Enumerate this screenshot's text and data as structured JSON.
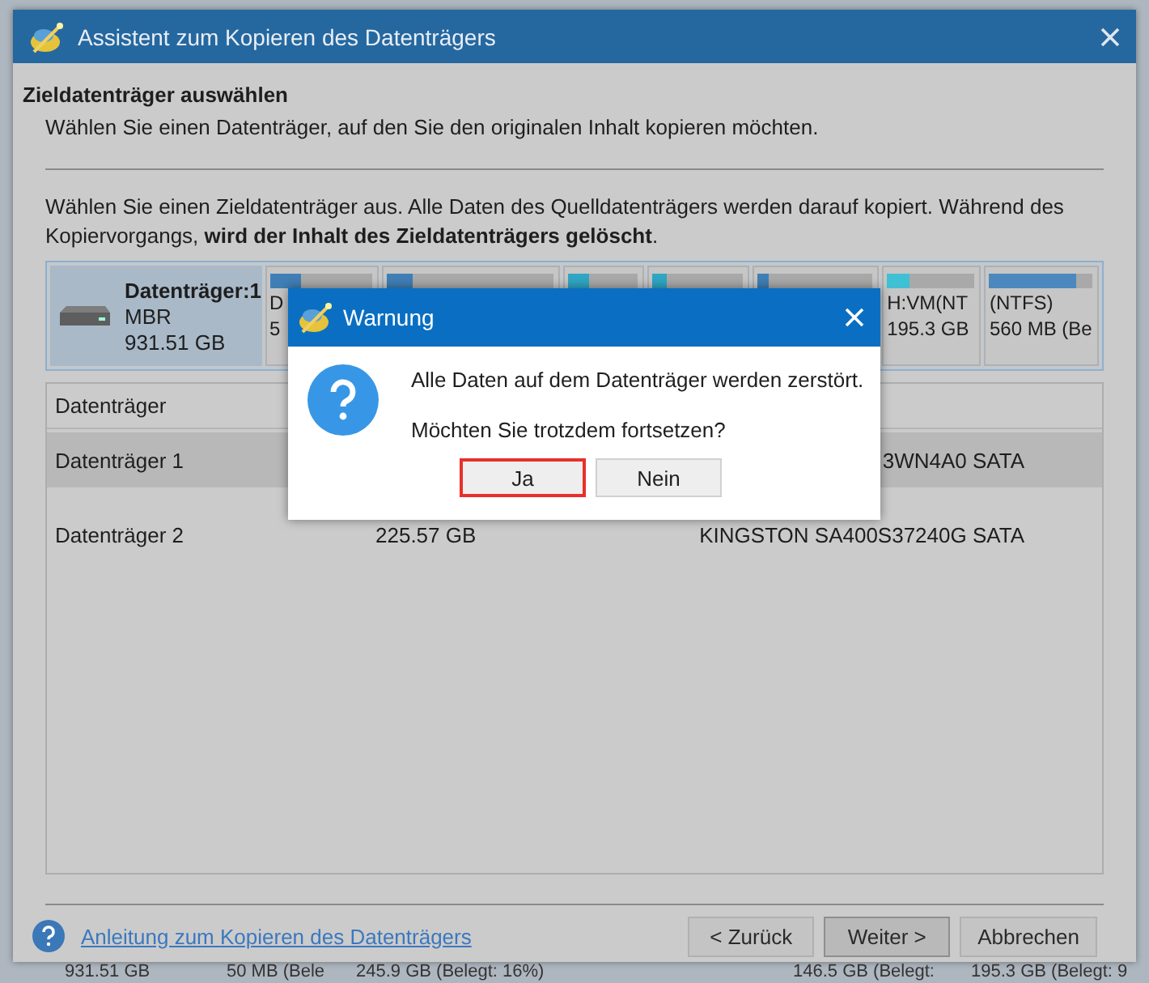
{
  "window": {
    "title": "Assistent zum Kopieren des Datenträgers"
  },
  "header": {
    "title": "Zieldatenträger auswählen",
    "subtitle": "Wählen Sie einen Datenträger, auf den Sie den originalen Inhalt kopieren möchten."
  },
  "description": "Wählen Sie einen Zieldatenträger aus. Alle Daten des Quelldatenträgers werden darauf kopiert. Während des Kopiervorgangs, **wird der Inhalt des Zieldatenträgers gelöscht**.",
  "disk_map": {
    "disk": {
      "name": "Datenträger:1",
      "type": "MBR",
      "size": "931.51 GB",
      "selected": true
    },
    "partitions": [
      {
        "label": "D",
        "size": "5",
        "level": 0.3
      },
      {
        "level": 0.15
      },
      {
        "level": 0.3
      },
      {
        "level": 0.15
      },
      {
        "level": 0.1
      },
      {
        "label": "H:VM(NT",
        "size": "195.3 GB",
        "level": 0.25
      },
      {
        "label": "(NTFS)",
        "size": "560 MB (Be",
        "level": 0.85
      }
    ]
  },
  "table": {
    "columns": [
      "Datenträger"
    ],
    "rows": [
      {
        "name": "Datenträger 1",
        "model": "3WN4A0 SATA",
        "selected": true
      },
      {
        "name": "Datenträger 2",
        "capacity": "225.57 GB",
        "model": "KINGSTON SA400S37240G SATA",
        "selected": false
      }
    ]
  },
  "footer": {
    "help_link": "Anleitung zum Kopieren des Datenträgers",
    "buttons": [
      {
        "label": "< Zurück",
        "default": false
      },
      {
        "label": "Weiter >",
        "default": true
      },
      {
        "label": "Abbrechen",
        "default": false
      }
    ]
  },
  "background_strip": [
    "931.51 GB",
    "50 MB (Bele",
    "245.9 GB (Belegt: 16%)",
    "146.5 GB (Belegt:",
    "195.3 GB (Belegt: 9"
  ],
  "dialog": {
    "title": "Warnung",
    "message": "Alle Daten auf dem Datenträger werden zerstört.",
    "question": "Möchten Sie trotzdem fortsetzen?",
    "buttons": [
      {
        "label": "Ja",
        "highlighted": true
      },
      {
        "label": "Nein",
        "highlighted": false
      }
    ]
  }
}
